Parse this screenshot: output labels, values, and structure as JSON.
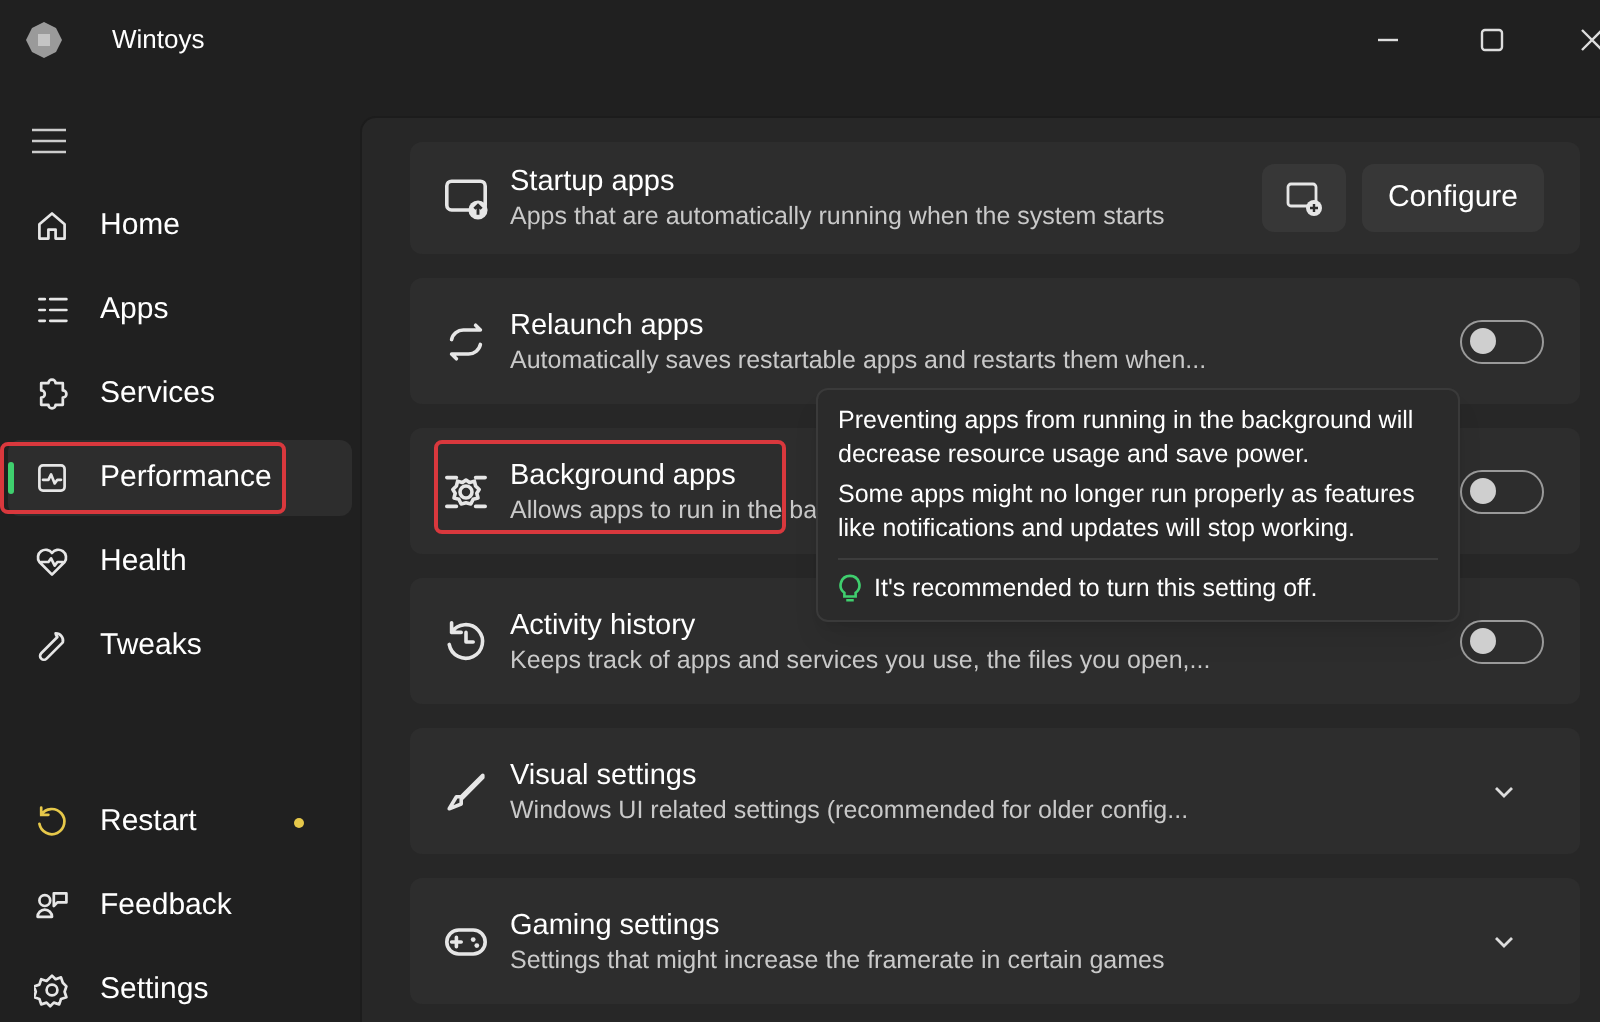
{
  "window": {
    "title": "Wintoys"
  },
  "sidebar": {
    "items": [
      {
        "label": "Home",
        "selected": false,
        "highlighted": false
      },
      {
        "label": "Apps",
        "selected": false,
        "highlighted": false
      },
      {
        "label": "Services",
        "selected": false,
        "highlighted": false
      },
      {
        "label": "Performance",
        "selected": true,
        "highlighted": true
      },
      {
        "label": "Health",
        "selected": false,
        "highlighted": false
      },
      {
        "label": "Tweaks",
        "selected": false,
        "highlighted": false
      }
    ],
    "footer_items": [
      {
        "label": "Restart",
        "alert": true
      },
      {
        "label": "Feedback",
        "alert": false
      },
      {
        "label": "Settings",
        "alert": false
      }
    ]
  },
  "cards": [
    {
      "kind": "button",
      "title": "Startup apps",
      "description": "Apps that are automatically running when the system starts",
      "button": "Configure",
      "highlighted": false
    },
    {
      "kind": "toggle",
      "title": "Relaunch apps",
      "description": "Automatically saves restartable apps and restarts them when...",
      "on": false,
      "highlighted": false
    },
    {
      "kind": "toggle",
      "title": "Background apps",
      "description": "Allows apps to run in the ba",
      "on": false,
      "highlighted": true
    },
    {
      "kind": "toggle",
      "title": "Activity history",
      "description": "Keeps track of apps and services you use, the files you open,...",
      "on": false,
      "highlighted": false
    },
    {
      "kind": "expander",
      "title": "Visual settings",
      "description": "Windows UI related settings (recommended for older config...",
      "expanded": false,
      "highlighted": false
    },
    {
      "kind": "expander",
      "title": "Gaming settings",
      "description": "Settings that might increase the framerate in certain games",
      "expanded": false,
      "highlighted": false
    }
  ],
  "tooltip": {
    "paragraphs": [
      "Preventing apps from running in the background will decrease resource usage and save power.",
      "Some apps might no longer run properly as features like notifications and updates will stop working."
    ],
    "tip": "It's recommended to turn this setting off."
  }
}
